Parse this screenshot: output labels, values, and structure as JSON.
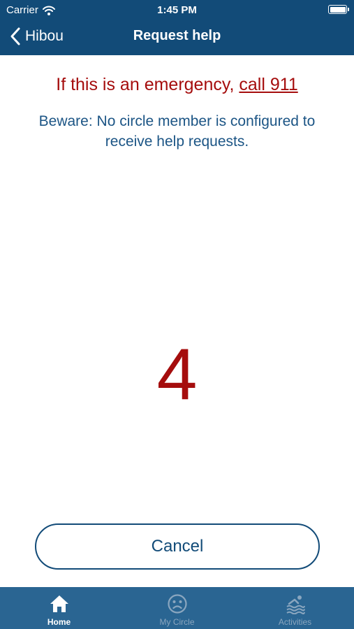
{
  "status_bar": {
    "carrier": "Carrier",
    "time": "1:45 PM"
  },
  "nav": {
    "back_label": "Hibou",
    "title": "Request help"
  },
  "emergency": {
    "text": "If this is an emergency, ",
    "link": "call 911"
  },
  "warning": "Beware: No circle member is configured to receive help requests.",
  "countdown": "4",
  "cancel_label": "Cancel",
  "tabs": [
    {
      "label": "Home",
      "icon": "home-icon",
      "active": true
    },
    {
      "label": "My Circle",
      "icon": "sad-face-icon",
      "active": false
    },
    {
      "label": "Activities",
      "icon": "swimmer-icon",
      "active": false
    }
  ],
  "colors": {
    "header": "#124b78",
    "tabbar": "#2a6592",
    "alert_red": "#a50d0d",
    "text_blue": "#1c5585"
  }
}
